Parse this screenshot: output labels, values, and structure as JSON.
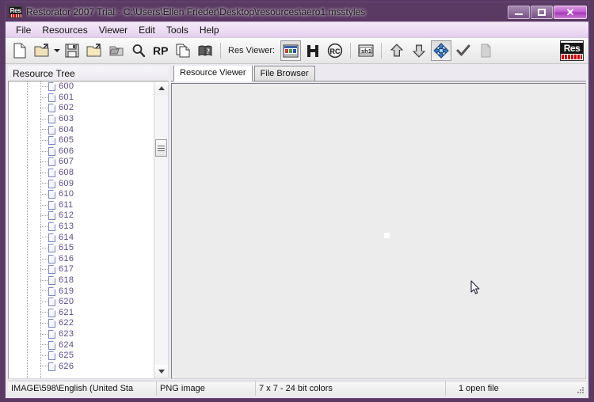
{
  "window": {
    "title": "Restorator 2007 Trial - C:\\Users\\Ellen Frieder\\Desktop\\resources\\aero1.msstyles",
    "app_icon_text": "Res",
    "controls": {
      "minimize": "Minimize",
      "maximize": "Maximize",
      "close": "Close"
    }
  },
  "menubar": {
    "items": [
      {
        "label": "File"
      },
      {
        "label": "Resources"
      },
      {
        "label": "Viewer"
      },
      {
        "label": "Edit"
      },
      {
        "label": "Tools"
      },
      {
        "label": "Help"
      }
    ]
  },
  "toolbar": {
    "res_viewer_label": "Res Viewer:",
    "logo_text": "Res",
    "buttons": [
      {
        "name": "new-file-icon",
        "title": "New"
      },
      {
        "name": "open-file-icon",
        "title": "Open"
      },
      {
        "name": "open-dropdown-caret",
        "title": "Open recent"
      },
      {
        "name": "save-icon",
        "title": "Save"
      },
      {
        "name": "open-folder-icon",
        "title": "Open folder"
      },
      {
        "name": "assign-folder-icon",
        "title": "Assign"
      },
      {
        "name": "find-icon",
        "title": "Find"
      },
      {
        "name": "rp-script-icon",
        "title": "RP"
      },
      {
        "name": "copy-pages-icon",
        "title": "Copy"
      },
      {
        "name": "book-icon",
        "title": "Help book"
      }
    ],
    "viewer_buttons": [
      {
        "name": "image-preview-icon",
        "title": "Image preview",
        "pressed": true
      },
      {
        "name": "hex-view-icon",
        "title": "Hex view",
        "label": "H"
      },
      {
        "name": "rc-view-icon",
        "title": "RC view",
        "label": "RC"
      },
      {
        "name": "string-view-icon",
        "title": "String view",
        "label": "sh1"
      },
      {
        "name": "extract-up-icon",
        "title": "Extract"
      },
      {
        "name": "assign-down-icon",
        "title": "Assign"
      },
      {
        "name": "move-mode-icon",
        "title": "Move",
        "pressed": true
      },
      {
        "name": "apply-check-icon",
        "title": "Apply"
      },
      {
        "name": "clipboard-icon",
        "title": "Clipboard"
      }
    ]
  },
  "tree": {
    "header": "Resource Tree",
    "items": [
      {
        "label": "600"
      },
      {
        "label": "601"
      },
      {
        "label": "602"
      },
      {
        "label": "603"
      },
      {
        "label": "604"
      },
      {
        "label": "605"
      },
      {
        "label": "606"
      },
      {
        "label": "607"
      },
      {
        "label": "608"
      },
      {
        "label": "609"
      },
      {
        "label": "610"
      },
      {
        "label": "611"
      },
      {
        "label": "612"
      },
      {
        "label": "613"
      },
      {
        "label": "614"
      },
      {
        "label": "615"
      },
      {
        "label": "616"
      },
      {
        "label": "617"
      },
      {
        "label": "618"
      },
      {
        "label": "619"
      },
      {
        "label": "620"
      },
      {
        "label": "621"
      },
      {
        "label": "622"
      },
      {
        "label": "623"
      },
      {
        "label": "624"
      },
      {
        "label": "625"
      },
      {
        "label": "626"
      }
    ]
  },
  "tabs": [
    {
      "label": "Resource Viewer",
      "active": true
    },
    {
      "label": "File Browser",
      "active": false
    }
  ],
  "statusbar": {
    "resource": "IMAGE\\598\\English (United Sta",
    "type": "PNG image",
    "dimensions": "7 x 7 - 24 bit colors",
    "open_files": "1 open file"
  },
  "colors": {
    "accent": "#a83ab8",
    "tree_label": "#5c4b8a",
    "viewer_background": "#ececec",
    "titlebar_purple": "#7d5494"
  }
}
